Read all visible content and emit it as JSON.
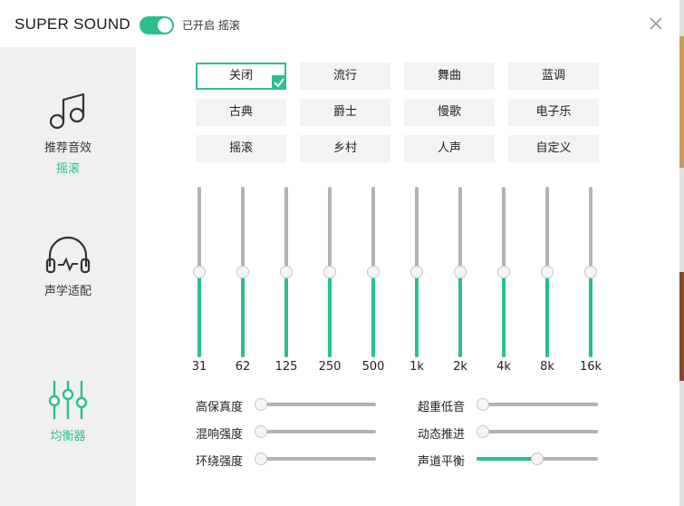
{
  "header": {
    "title": "SUPER SOUND",
    "status": "已开启 摇滚",
    "toggle_on": true
  },
  "sidebar": {
    "items": [
      {
        "label": "推荐音效",
        "sub": "摇滚",
        "icon": "music-note-icon"
      },
      {
        "label": "声学适配",
        "icon": "headphones-icon"
      },
      {
        "label": "均衡器",
        "icon": "equalizer-icon",
        "active": true
      }
    ]
  },
  "presets": {
    "rows": [
      [
        "关闭",
        "流行",
        "舞曲",
        "蓝调"
      ],
      [
        "古典",
        "爵士",
        "慢歌",
        "电子乐"
      ],
      [
        "摇滚",
        "乡村",
        "人声",
        "自定义"
      ]
    ],
    "selected": "关闭"
  },
  "eq": {
    "bands": [
      {
        "label": "31",
        "level": 0.5
      },
      {
        "label": "62",
        "level": 0.5
      },
      {
        "label": "125",
        "level": 0.5
      },
      {
        "label": "250",
        "level": 0.5
      },
      {
        "label": "500",
        "level": 0.5
      },
      {
        "label": "1k",
        "level": 0.5
      },
      {
        "label": "2k",
        "level": 0.5
      },
      {
        "label": "4k",
        "level": 0.5
      },
      {
        "label": "8k",
        "level": 0.5
      },
      {
        "label": "16k",
        "level": 0.5
      }
    ]
  },
  "effects": {
    "left": [
      {
        "label": "高保真度",
        "level": 0
      },
      {
        "label": "混响强度",
        "level": 0
      },
      {
        "label": "环绕强度",
        "level": 0
      }
    ],
    "right": [
      {
        "label": "超重低音",
        "level": 0
      },
      {
        "label": "动态推进",
        "level": 0
      },
      {
        "label": "声道平衡",
        "level": 0.5
      }
    ]
  },
  "colors": {
    "accent": "#2bbf8c",
    "track": "#b3b3b3"
  }
}
